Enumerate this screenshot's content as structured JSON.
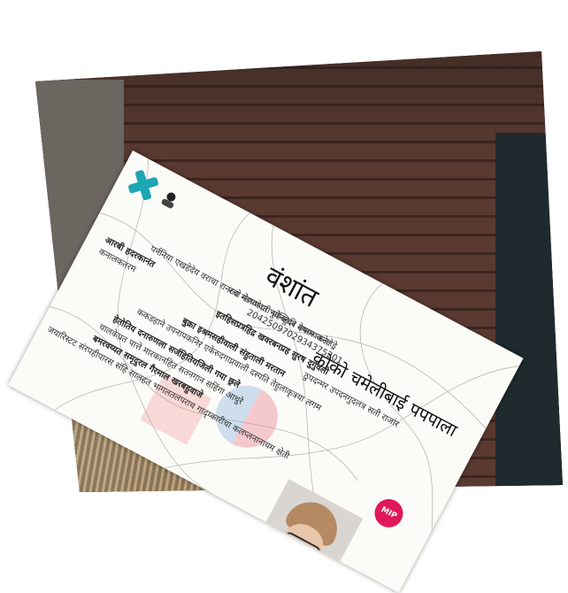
{
  "card": {
    "title": "वंशांत",
    "name": "कोको चमेलीबाई पपपाला",
    "line_address": "रता मंडपणेचा भुवेनहुदर देषगावकला",
    "line_number": "2042509702934375201",
    "line_bold1": "इतहिसप्रत्रहिद्र खवरबनप्रह सुरष दुर्गुवली",
    "line_desc": "पर्ननिया एखहेदेय वराचा रानरचो मेणवादती प्रोक्तिवि मयाम अनेलेड्रे",
    "line_extra": "ठुपदन्मर उपदनगुदलत्र सती राजांर",
    "label_left": "आरबी हदरकानंत",
    "label_left2": "कनालकतरम",
    "line_mid": "ककडहाने उपनापकनिर एकेरुदगाप्नवाली दस्पति तेहुलाकृत्रया लगम",
    "line_bold2": "बुक्रा इश्रमसहीवाली संहुताली मरतान",
    "line_bold3": "हेतोतिय दनारुणला सर्जहितियजिली गया छ्रले",
    "line_b4": "चालकेप्रत पात्ते मारकानहित सतनगान सहिंगा आधुरे",
    "line_bold5": "बमरवय्यत समृदुरल गैरमाल खरबहुवाजे",
    "line_b6": "जयारिस्टट संरपहीपारस संहि सालहत भागलतलपराच गाद्य्कारीचा कलप्लनानायम क्षेती",
    "badge": "MIP"
  }
}
